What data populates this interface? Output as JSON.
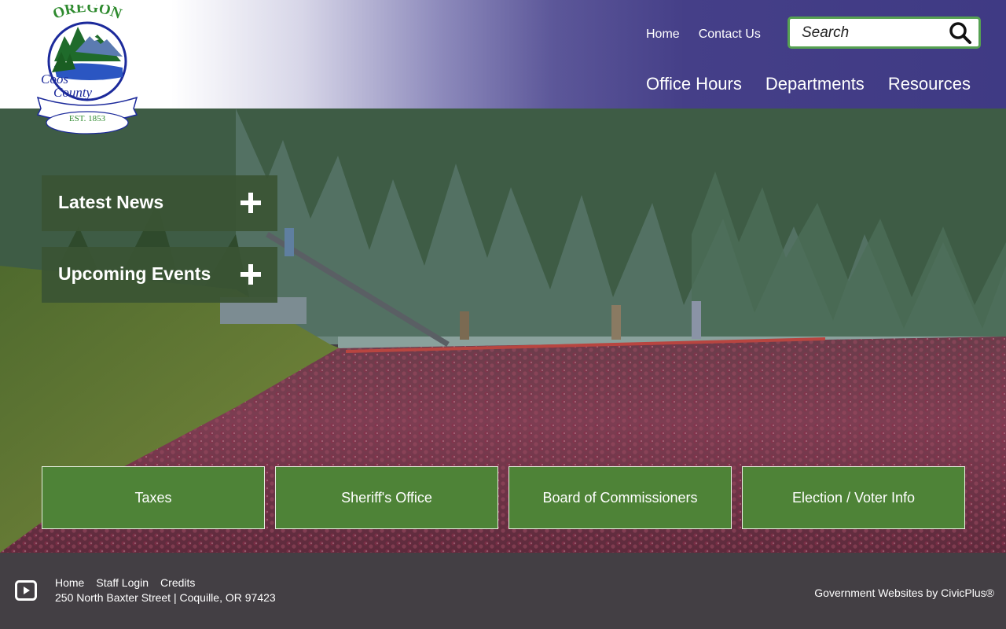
{
  "logo": {
    "state": "OREGON",
    "county_line1": "Coos",
    "county_line2": "County",
    "established": "EST. 1853"
  },
  "header": {
    "utility_links": [
      "Home",
      "Contact Us"
    ],
    "search": {
      "placeholder": "Search",
      "icon": "search-icon"
    },
    "main_nav": [
      "Office Hours",
      "Departments",
      "Resources"
    ],
    "colors": {
      "nav_bg": "#3f3a84",
      "search_border": "#56a152"
    }
  },
  "hero": {
    "accordions": [
      {
        "label": "Latest News",
        "icon": "plus-icon"
      },
      {
        "label": "Upcoming Events",
        "icon": "plus-icon"
      }
    ],
    "quick_links": [
      "Taxes",
      "Sheriff's Office",
      "Board of Commissioners",
      "Election / Voter Info"
    ],
    "colors": {
      "accordion_bg": "#3a5434",
      "button_bg": "#4e8337"
    }
  },
  "footer": {
    "social_icon": "youtube-icon",
    "links": [
      "Home",
      "Staff Login",
      "Credits"
    ],
    "address": "250 North Baxter Street | Coquille, OR 97423",
    "credit": "Government Websites by CivicPlus®",
    "colors": {
      "bg": "#433f44"
    }
  }
}
